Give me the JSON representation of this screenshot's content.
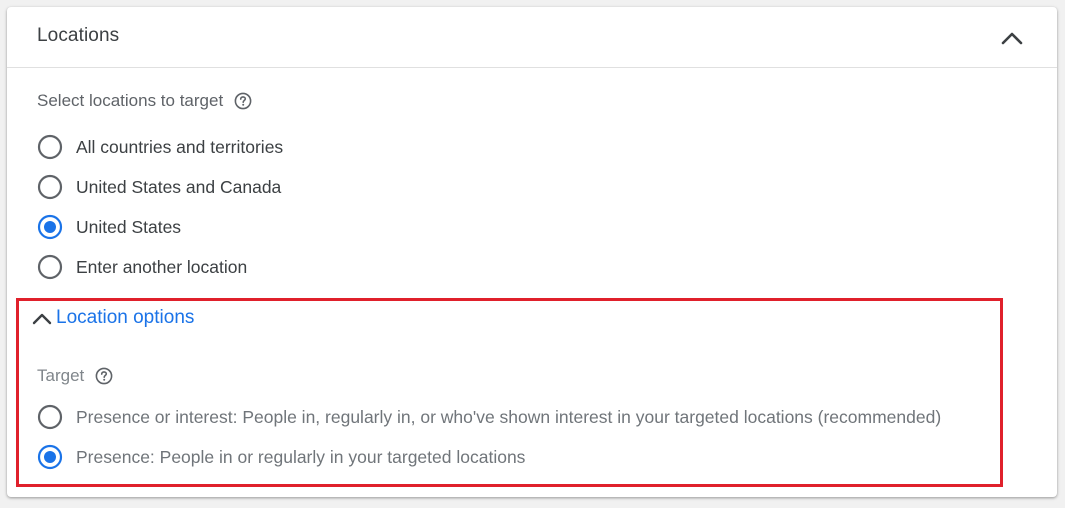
{
  "header": {
    "title": "Locations"
  },
  "select_locations": {
    "label": "Select locations to target",
    "options": [
      {
        "label": "All countries and territories",
        "selected": false
      },
      {
        "label": "United States and Canada",
        "selected": false
      },
      {
        "label": "United States",
        "selected": true
      },
      {
        "label": "Enter another location",
        "selected": false
      }
    ]
  },
  "location_options": {
    "toggle_label": "Location options",
    "expanded": true,
    "target": {
      "label": "Target",
      "options": [
        {
          "label": "Presence or interest: People in, regularly in, or who've shown interest in your targeted locations (recommended)",
          "selected": false
        },
        {
          "label": "Presence: People in or regularly in your targeted locations",
          "selected": true
        }
      ]
    }
  },
  "colors": {
    "accent": "#1a73e8",
    "highlight": "#e0202b",
    "text": "#3c4043",
    "muted": "#70757a"
  }
}
